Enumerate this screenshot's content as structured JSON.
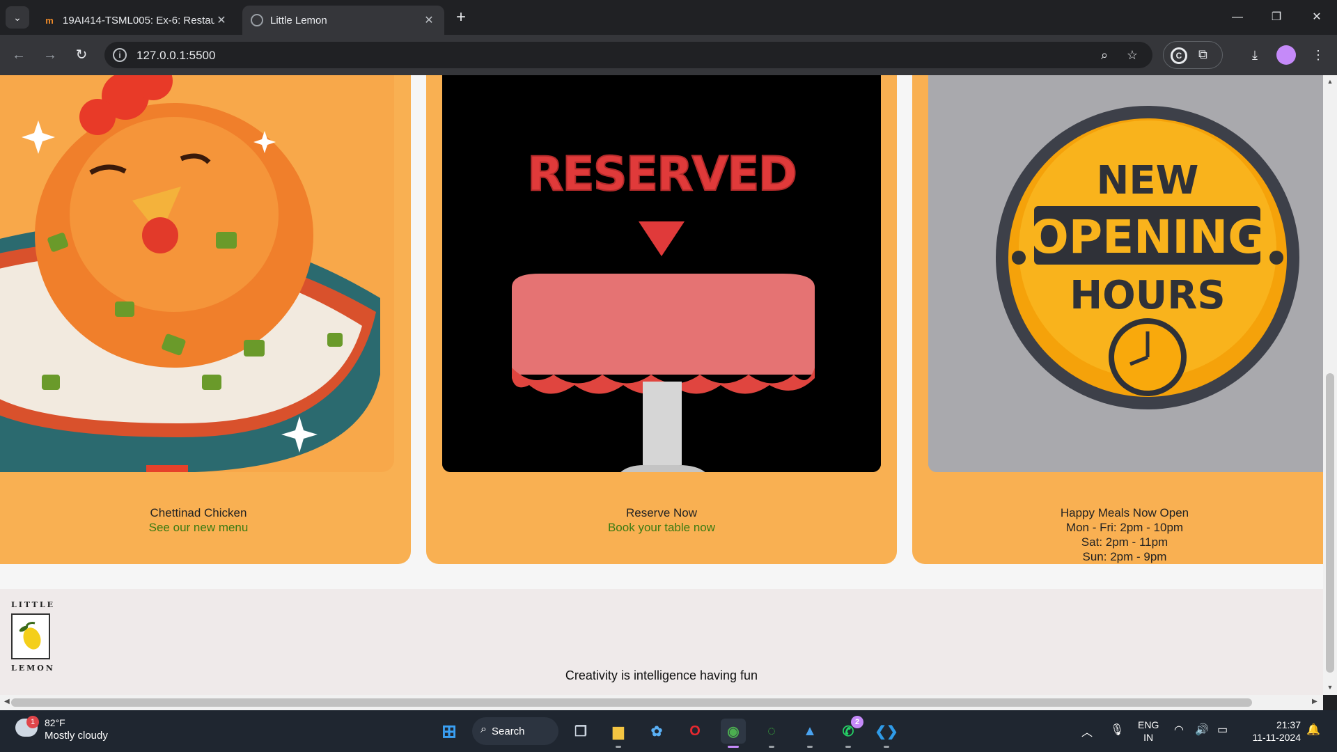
{
  "browser": {
    "tabs": [
      {
        "title": "19AI414-TSML005: Ex-6: Restau",
        "favicon": "moodle-icon",
        "active": false
      },
      {
        "title": "Little Lemon",
        "favicon": "globe-icon",
        "active": true
      }
    ],
    "url": "127.0.0.1:5500"
  },
  "page": {
    "cards": [
      {
        "title": "Chettinad Chicken",
        "link": "See our new menu",
        "image": "chicken-rice-bowl-illustration"
      },
      {
        "title": "Reserve Now",
        "link": "Book your table now",
        "image": "reserved-table-pixel-art",
        "image_text": "RESERVED"
      },
      {
        "title": "Happy Meals Now Open",
        "hours": [
          "Mon - Fri: 2pm - 10pm",
          "Sat: 2pm - 11pm",
          "Sun: 2pm - 9pm"
        ],
        "image": "new-opening-hours-badge",
        "badge_lines": [
          "NEW",
          "OPENING",
          "HOURS"
        ]
      }
    ],
    "footer": {
      "logo_top": "LITTLE",
      "logo_bottom": "LEMON",
      "tagline": "Creativity is intelligence having fun"
    }
  },
  "taskbar": {
    "weather": {
      "temp": "82°F",
      "condition": "Mostly cloudy",
      "badge": "1"
    },
    "search_label": "Search",
    "whatsapp_badge": "2",
    "chrome_badge": "",
    "language": "ENG",
    "region": "IN",
    "time": "21:37",
    "date": "11-11-2024"
  },
  "colors": {
    "card_bg": "#f9b052",
    "link_green": "#3a7a12",
    "footer_bg": "#efeaea",
    "reserved_red": "#e03a3a"
  }
}
